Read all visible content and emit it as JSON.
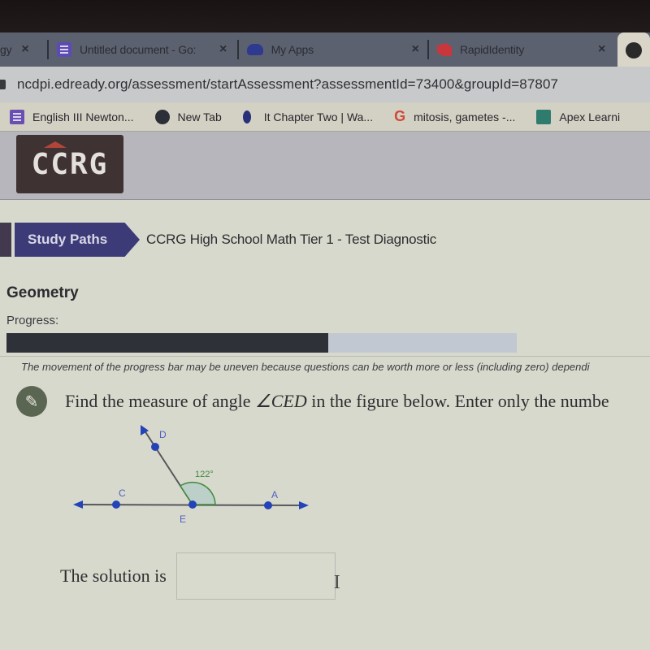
{
  "browser": {
    "tabs": [
      {
        "label": "gy",
        "icon": "unknown-icon",
        "active": false
      },
      {
        "label": "Untitled document - Go:",
        "icon": "google-docs-icon",
        "active": false
      },
      {
        "label": "My Apps",
        "icon": "cloud-icon",
        "active": false
      },
      {
        "label": "RapidIdentity",
        "icon": "rapididentity-icon",
        "active": false
      },
      {
        "label": "",
        "icon": "avatar-icon",
        "active": true
      }
    ],
    "close_glyph": "×",
    "url": "ncdpi.edready.org/assessment/startAssessment?assessmentId=73400&groupId=87807",
    "bookmarks": [
      {
        "label": "English III Newton...",
        "icon": "google-docs-icon"
      },
      {
        "label": "New Tab",
        "icon": "globe-icon"
      },
      {
        "label": "It Chapter Two | Wa...",
        "icon": "drop-icon"
      },
      {
        "label": "mitosis, gametes -...",
        "icon": "google-icon",
        "glyph": "G"
      },
      {
        "label": "Apex Learni",
        "icon": "apex-icon"
      }
    ]
  },
  "app": {
    "logo": "CCRG",
    "breadcrumb": {
      "study_paths": "Study Paths",
      "title": "CCRG High School Math Tier 1 - Test Diagnostic"
    },
    "subject": "Geometry",
    "progress": {
      "label": "Progress:",
      "percent": 63,
      "note": "The movement of the progress bar may be uneven because questions can be worth more or less (including zero) dependi"
    },
    "question": {
      "pencil_glyph": "✎",
      "text_before": "Find the measure of angle ",
      "math": "∠CED",
      "text_after": " in the figure below. Enter only the numbe"
    },
    "figure": {
      "points": {
        "C": "C",
        "D": "D",
        "E": "E",
        "A": "A"
      },
      "angle_label": "122°",
      "angle_color": "#3f8a3a",
      "point_color": "#2443b8",
      "label_color": "#5060c0"
    },
    "solution": {
      "label": "The solution is",
      "value": "",
      "cursor": "I"
    }
  }
}
